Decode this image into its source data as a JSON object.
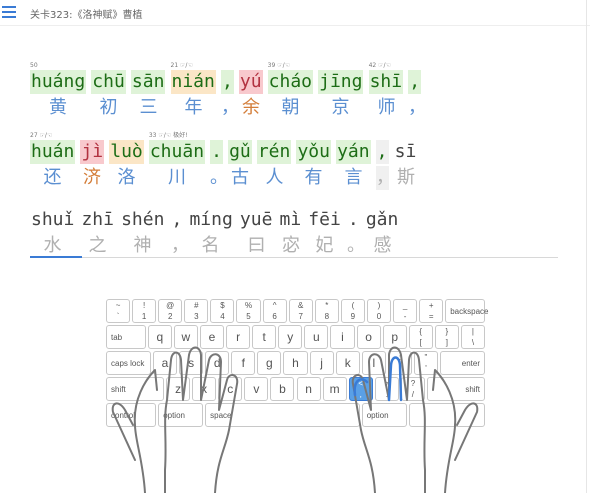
{
  "header": {
    "title": "关卡323:《洛神赋》曹植"
  },
  "lines": [
    {
      "syllables": [
        {
          "py": "huáng",
          "note": "50",
          "st": "ok"
        },
        {
          "py": "chū",
          "note": "",
          "st": "ok"
        },
        {
          "py": "sān",
          "note": "",
          "st": "ok"
        },
        {
          "py": "nián",
          "note": "21 ☞/☜",
          "st": "warn"
        },
        {
          "py": ",",
          "note": "",
          "st": "ok"
        },
        {
          "py": "yú",
          "note": "",
          "st": "err"
        },
        {
          "py": "cháo",
          "note": "39 ☞/☜",
          "st": "ok"
        },
        {
          "py": "jīng",
          "note": "",
          "st": "ok"
        },
        {
          "py": "shī",
          "note": "42 ☞/☜",
          "st": "ok"
        },
        {
          "py": ",",
          "note": "",
          "st": "ok"
        }
      ],
      "hanzi": [
        {
          "c": "黄",
          "st": "ok"
        },
        {
          "c": "初",
          "st": "ok"
        },
        {
          "c": "三",
          "st": "ok"
        },
        {
          "c": "年",
          "st": "ok"
        },
        {
          "c": "，",
          "st": "ok"
        },
        {
          "c": "余",
          "st": "err"
        },
        {
          "c": "朝",
          "st": "ok"
        },
        {
          "c": "京",
          "st": "ok"
        },
        {
          "c": "师",
          "st": "ok"
        },
        {
          "c": "，",
          "st": "ok"
        }
      ]
    },
    {
      "syllables": [
        {
          "py": "huán",
          "note": "27 ☞/☜",
          "st": "ok"
        },
        {
          "py": "jì",
          "note": "",
          "st": "err"
        },
        {
          "py": "luò",
          "note": "",
          "st": "warn"
        },
        {
          "py": "chuān",
          "note": "33 ☞/☜ 极好!",
          "st": "ok"
        },
        {
          "py": ".",
          "note": "",
          "st": "ok"
        },
        {
          "py": "gǔ",
          "note": "",
          "st": "ok"
        },
        {
          "py": "rén",
          "note": "",
          "st": "ok"
        },
        {
          "py": "yǒu",
          "note": "",
          "st": "ok"
        },
        {
          "py": "yán",
          "note": "",
          "st": "ok"
        },
        {
          "py": ",",
          "note": "",
          "st": "cur"
        },
        {
          "py": "sī",
          "note": "",
          "st": "pend"
        }
      ],
      "hanzi": [
        {
          "c": "还",
          "st": "ok"
        },
        {
          "c": "济",
          "st": "err"
        },
        {
          "c": "洛",
          "st": "ok"
        },
        {
          "c": "川",
          "st": "ok"
        },
        {
          "c": "。",
          "st": "ok"
        },
        {
          "c": "古",
          "st": "ok"
        },
        {
          "c": "人",
          "st": "ok"
        },
        {
          "c": "有",
          "st": "ok"
        },
        {
          "c": "言",
          "st": "ok"
        },
        {
          "c": "，",
          "st": "cur"
        },
        {
          "c": "斯",
          "st": "pend"
        }
      ]
    },
    {
      "syllables": [
        {
          "py": "shuǐ",
          "note": "",
          "st": "pend"
        },
        {
          "py": "zhī",
          "note": "",
          "st": "pend"
        },
        {
          "py": "shén",
          "note": "",
          "st": "pend"
        },
        {
          "py": ",",
          "note": "",
          "st": "pend"
        },
        {
          "py": "míng",
          "note": "",
          "st": "pend"
        },
        {
          "py": "yuē",
          "note": "",
          "st": "pend"
        },
        {
          "py": "mì",
          "note": "",
          "st": "pend"
        },
        {
          "py": "fēi",
          "note": "",
          "st": "pend"
        },
        {
          "py": ".",
          "note": "",
          "st": "pend"
        },
        {
          "py": "gǎn",
          "note": "",
          "st": "pend"
        }
      ],
      "hanzi": [
        {
          "c": "水",
          "st": "pend"
        },
        {
          "c": "之",
          "st": "pend"
        },
        {
          "c": "神",
          "st": "pend"
        },
        {
          "c": "，",
          "st": "pend"
        },
        {
          "c": "名",
          "st": "pend"
        },
        {
          "c": "曰",
          "st": "pend"
        },
        {
          "c": "宓",
          "st": "pend"
        },
        {
          "c": "妃",
          "st": "pend"
        },
        {
          "c": "。",
          "st": "pend"
        },
        {
          "c": "感",
          "st": "pend"
        }
      ]
    }
  ],
  "keyboard": {
    "row1": [
      [
        "~",
        "`"
      ],
      [
        "!",
        "1"
      ],
      [
        "@",
        "2"
      ],
      [
        "#",
        "3"
      ],
      [
        "$",
        "4"
      ],
      [
        "%",
        "5"
      ],
      [
        "^",
        "6"
      ],
      [
        "&",
        "7"
      ],
      [
        "*",
        "8"
      ],
      [
        "(",
        "9"
      ],
      [
        ")",
        "0"
      ],
      [
        "_",
        "-"
      ],
      [
        "+",
        "="
      ],
      [
        "backspace",
        ""
      ]
    ],
    "row2": [
      [
        "tab",
        ""
      ],
      [
        "q",
        ""
      ],
      [
        "w",
        ""
      ],
      [
        "e",
        ""
      ],
      [
        "r",
        ""
      ],
      [
        "t",
        ""
      ],
      [
        "y",
        ""
      ],
      [
        "u",
        ""
      ],
      [
        "i",
        ""
      ],
      [
        "o",
        ""
      ],
      [
        "p",
        ""
      ],
      [
        "{",
        "["
      ],
      [
        "}",
        "]"
      ],
      [
        "|",
        "\\"
      ]
    ],
    "row3": [
      [
        "caps lock",
        ""
      ],
      [
        "a",
        ""
      ],
      [
        "s",
        ""
      ],
      [
        "d",
        ""
      ],
      [
        "f",
        ""
      ],
      [
        "g",
        ""
      ],
      [
        "h",
        ""
      ],
      [
        "j",
        ""
      ],
      [
        "k",
        ""
      ],
      [
        "l",
        ""
      ],
      [
        ":",
        ";"
      ],
      [
        "\"",
        "'"
      ],
      [
        "enter",
        ""
      ]
    ],
    "row4": [
      [
        "shift",
        ""
      ],
      [
        "z",
        ""
      ],
      [
        "x",
        ""
      ],
      [
        "c",
        ""
      ],
      [
        "v",
        ""
      ],
      [
        "b",
        ""
      ],
      [
        "n",
        ""
      ],
      [
        "m",
        ""
      ],
      [
        "<",
        ","
      ],
      [
        ">",
        "."
      ],
      [
        "?",
        "/"
      ],
      [
        "shift",
        ""
      ]
    ],
    "row5": [
      [
        "control",
        ""
      ],
      [
        "option",
        ""
      ],
      [
        "space",
        ""
      ],
      [
        "option",
        ""
      ],
      [
        "",
        ""
      ]
    ],
    "highlight_key": "<",
    "colors": {
      "highlight": "#5aa0e6",
      "finger": "#3a7bd5"
    }
  }
}
